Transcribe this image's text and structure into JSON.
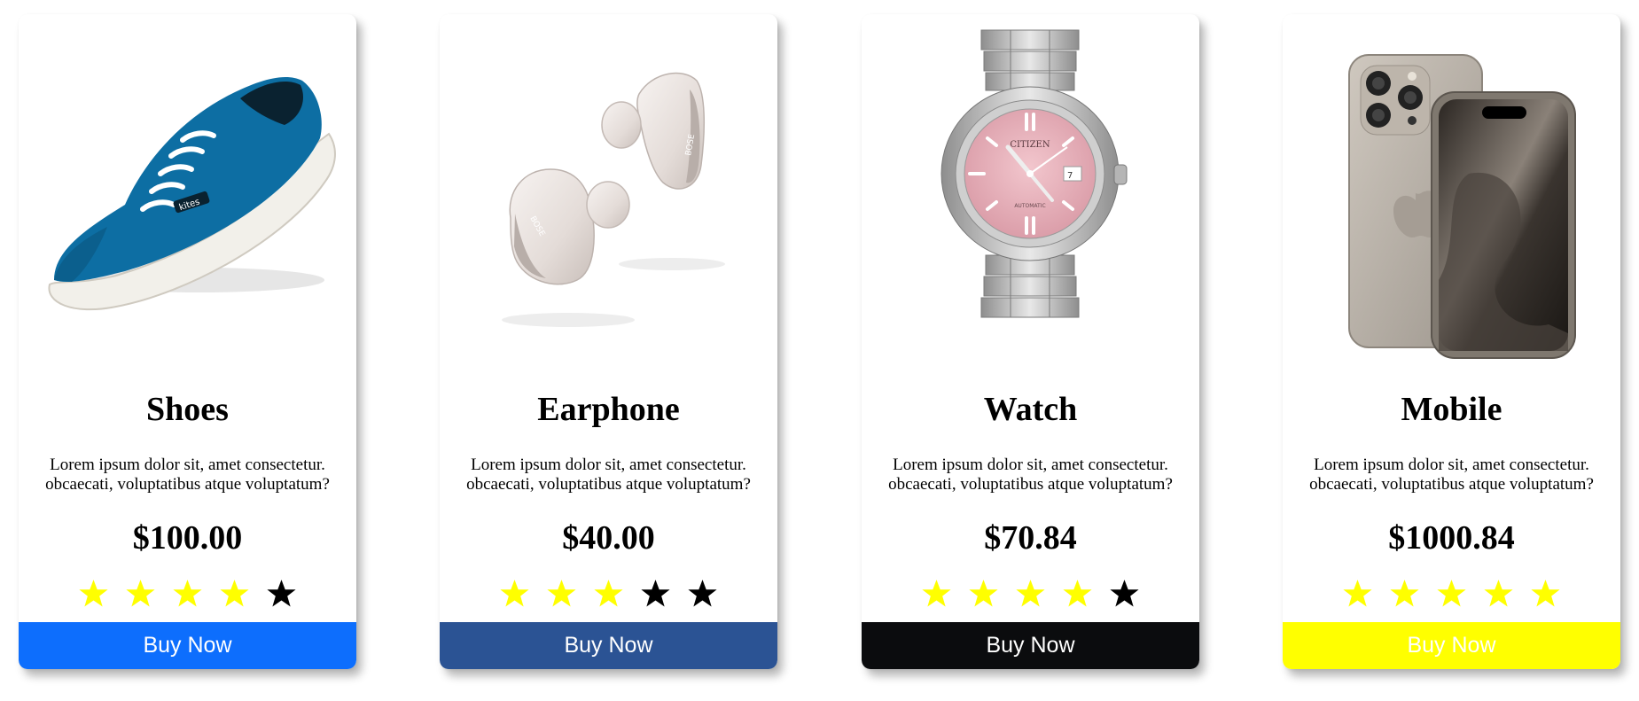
{
  "products": [
    {
      "name": "Shoes",
      "description": "Lorem ipsum dolor sit, amet consectetur. obcaecati, voluptatibus atque voluptatum?",
      "price": "$100.00",
      "rating": 4,
      "rating_max": 5,
      "image_icon": "shoe-icon",
      "button_label": "Buy Now",
      "button_color": "#0d6efd",
      "button_text_color": "#ffffff"
    },
    {
      "name": "Earphone",
      "description": "Lorem ipsum dolor sit, amet consectetur. obcaecati, voluptatibus atque voluptatum?",
      "price": "$40.00",
      "rating": 3,
      "rating_max": 5,
      "image_icon": "earbuds-icon",
      "button_label": "Buy Now",
      "button_color": "#2b5394",
      "button_text_color": "#ffffff"
    },
    {
      "name": "Watch",
      "description": "Lorem ipsum dolor sit, amet consectetur. obcaecati, voluptatibus atque voluptatum?",
      "price": "$70.84",
      "rating": 4,
      "rating_max": 5,
      "image_icon": "watch-icon",
      "image_brand_text": "CITIZEN",
      "image_sub_text": "AUTOMATIC",
      "button_label": "Buy Now",
      "button_color": "#0b0c0e",
      "button_text_color": "#ffffff"
    },
    {
      "name": "Mobile",
      "description": "Lorem ipsum dolor sit, amet consectetur. obcaecati, voluptatibus atque voluptatum?",
      "price": "$1000.84",
      "rating": 5,
      "rating_max": 5,
      "image_icon": "phone-icon",
      "button_label": "Buy Now",
      "button_color": "#ffff00",
      "button_text_color": "#ffffff"
    }
  ],
  "colors": {
    "star_filled": "#ffff00",
    "star_empty": "#000000"
  }
}
